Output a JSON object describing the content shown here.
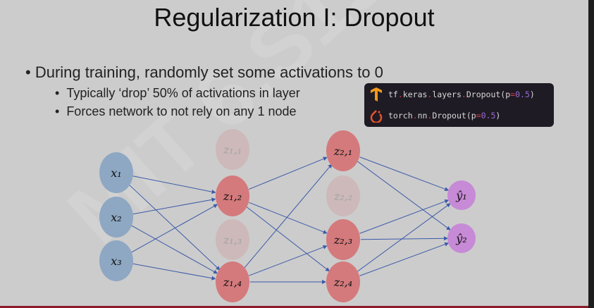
{
  "title": "Regularization I: Dropout",
  "bullets": {
    "main": "During training, randomly set some activations to 0",
    "sub": [
      "Typically ‘drop’ 50% of activations in layer",
      "Forces network to not rely on any 1 node"
    ]
  },
  "code": {
    "tf": {
      "a": "tf",
      "b": "keras",
      "c": "layers",
      "d": "Dropout(p",
      "v": "0.5",
      "e": ")"
    },
    "torch": {
      "a": "torch",
      "b": "nn",
      "d": "Dropout(p",
      "v": "0.5",
      "e": ")"
    }
  },
  "watermark": "MIT 6.S191",
  "nodes": {
    "x1": "x₁",
    "x2": "x₂",
    "x3": "x₃",
    "z11": "z₁,₁",
    "z12": "z₁,₂",
    "z13": "z₁,₃",
    "z14": "z₁,₄",
    "z21": "z₂,₁",
    "z22": "z₂,₂",
    "z23": "z₂,₃",
    "z24": "z₂,₄",
    "y1": "ŷ₁",
    "y2": "ŷ₂"
  },
  "colors": {
    "input": "#8ea7c3",
    "hidden": "#d47a7c",
    "output": "#c78ad6",
    "edge": "#3b5aa8"
  }
}
